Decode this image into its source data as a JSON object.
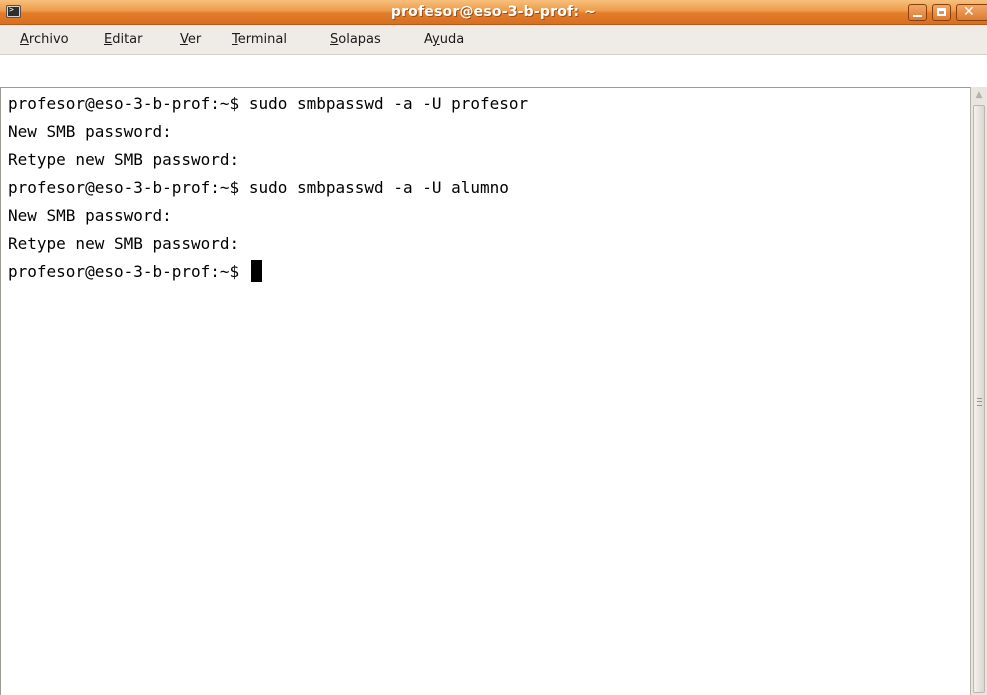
{
  "window": {
    "title": "profesor@eso-3-b-prof: ~",
    "controls": {
      "minimize": "minimize-icon",
      "maximize": "maximize-icon",
      "close": "close-icon"
    }
  },
  "colors": {
    "titlebar": "#e27c2a",
    "menubar": "#efebe7",
    "terminal_bg": "#ffffff",
    "terminal_fg": "#000000"
  },
  "menubar": {
    "items": [
      {
        "mnemonic": "A",
        "rest": "rchivo"
      },
      {
        "mnemonic": "E",
        "rest": "ditar"
      },
      {
        "mnemonic": "V",
        "rest": "er"
      },
      {
        "mnemonic": "T",
        "rest": "erminal"
      },
      {
        "mnemonic": "S",
        "rest": "olapas"
      },
      {
        "prefix": "A",
        "mnemonic": "y",
        "rest": "uda"
      }
    ]
  },
  "terminal": {
    "prompt": "profesor@eso-3-b-prof:~$ ",
    "lines": [
      "profesor@eso-3-b-prof:~$ sudo smbpasswd -a -U profesor",
      "New SMB password:",
      "Retype new SMB password:",
      "profesor@eso-3-b-prof:~$ sudo smbpasswd -a -U alumno",
      "New SMB password:",
      "Retype new SMB password:"
    ]
  }
}
